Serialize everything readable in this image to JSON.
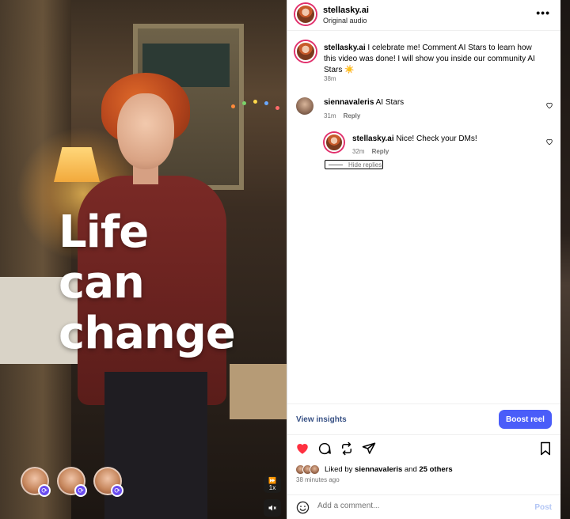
{
  "video": {
    "overlay_line1": "Life can",
    "overlay_line2": "change",
    "speed_label": "1x",
    "collaborators": [
      {
        "icon": "collab-badge-icon"
      },
      {
        "icon": "collab-badge-icon"
      },
      {
        "icon": "collab-badge-icon"
      }
    ]
  },
  "header": {
    "username": "stellasky.ai",
    "subtitle": "Original audio",
    "more_label": "•••"
  },
  "caption": {
    "username": "stellasky.ai",
    "text": " I celebrate me! Comment AI Stars to learn how this video was done! I will show you inside our community AI Stars ☀️",
    "time": "38m"
  },
  "comments": [
    {
      "username": "siennavaleris",
      "text": " AI Stars",
      "time": "31m",
      "reply_label": "Reply"
    }
  ],
  "replies": [
    {
      "username": "stellasky.ai",
      "text": " Nice! Check your DMs!",
      "time": "32m",
      "reply_label": "Reply"
    }
  ],
  "hide_replies_label": "Hide replies",
  "insights": {
    "view_label": "View insights",
    "boost_label": "Boost reel"
  },
  "likes": {
    "prefix": "Liked by ",
    "first_user": "siennavaleris",
    "joiner": " and ",
    "others": "25 others",
    "time": "38 minutes ago"
  },
  "composer": {
    "placeholder": "Add a comment...",
    "post_label": "Post"
  },
  "colors": {
    "like_active": "#ff3040",
    "boost_bg": "#4a5df9",
    "link": "#385185",
    "post_disabled": "#b3c6f5",
    "story_ring": "#e1306c"
  }
}
